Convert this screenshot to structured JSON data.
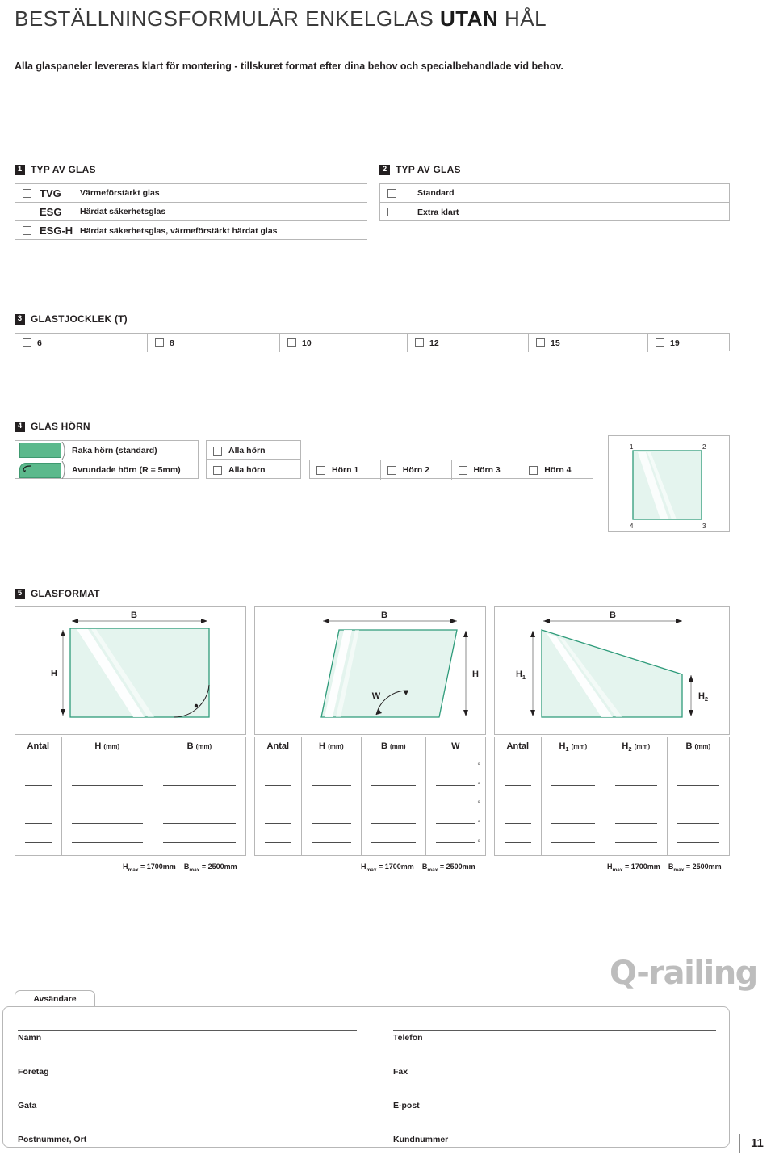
{
  "header": {
    "title_normal_1": "BESTÄLLNINGSFORMULÄR ENKELGLAS ",
    "title_bold": "UTAN",
    "title_normal_2": " HÅL",
    "subtitle": "Alla glaspaneler levereras klart för montering - tillskuret format efter dina behov och specialbehandlade vid behov."
  },
  "colors": {
    "glass_fill": "#e4f4ee",
    "glass_stroke": "#2e9b7a",
    "swatch_green": "#5cb98c",
    "rule": "#b7b7b7",
    "logo_gray": "#bdbdbd"
  },
  "section1": {
    "number": "1",
    "title": "TYP AV GLAS",
    "options": [
      {
        "code": "TVG",
        "desc": "Värmeförstärkt glas"
      },
      {
        "code": "ESG",
        "desc": "Härdat säkerhetsglas"
      },
      {
        "code": "ESG-H",
        "desc": "Härdat säkerhetsglas, värmeförstärkt härdat glas"
      }
    ]
  },
  "section2": {
    "number": "2",
    "title": "TYP AV GLAS",
    "options": [
      {
        "label": "Standard"
      },
      {
        "label": "Extra klart"
      }
    ]
  },
  "section3": {
    "number": "3",
    "title": "GLASTJOCKLEK (T)",
    "thicknesses": [
      "6",
      "8",
      "10",
      "12",
      "15",
      "19"
    ]
  },
  "section4": {
    "number": "4",
    "title": "GLAS HÖRN",
    "types": [
      {
        "label": "Raka hörn (standard)",
        "swatch": "square-corner-swatch"
      },
      {
        "label": "Avrundade hörn (R = 5mm)",
        "swatch": "rounded-corner-swatch"
      }
    ],
    "all_corners_1": "Alla hörn",
    "all_corners_2": "Alla hörn",
    "corners": [
      "Hörn 1",
      "Hörn 2",
      "Hörn 3",
      "Hörn 4"
    ],
    "diagram_corner_labels": [
      "1",
      "2",
      "3",
      "4"
    ]
  },
  "section5": {
    "number": "5",
    "title": "GLASFORMAT",
    "figures": [
      {
        "name": "rectangle-glass",
        "labels": {
          "b": "B",
          "h": "H"
        }
      },
      {
        "name": "parallelogram-glass",
        "labels": {
          "b": "B",
          "h": "H",
          "w": "W"
        }
      },
      {
        "name": "trapezoid-glass",
        "labels": {
          "b": "B",
          "h1": "H",
          "h1sub": "1",
          "h2": "H",
          "h2sub": "2"
        }
      }
    ],
    "tables": [
      {
        "name": "rectangle-table",
        "headers": [
          {
            "main": "Antal",
            "unit": ""
          },
          {
            "main": "H",
            "unit": "(mm)"
          },
          {
            "main": "B",
            "unit": "(mm)"
          }
        ],
        "rows": 5,
        "max_note": {
          "h": "H",
          "hsub": "max",
          "heq": "= 1700mm",
          "dash": "–",
          "b": "B",
          "bsub": "max",
          "beq": "= 2500mm"
        }
      },
      {
        "name": "parallelogram-table",
        "headers": [
          {
            "main": "Antal",
            "unit": ""
          },
          {
            "main": "H",
            "unit": "(mm)"
          },
          {
            "main": "B",
            "unit": "(mm)"
          },
          {
            "main": "W",
            "unit": ""
          }
        ],
        "rows": 5,
        "degree_symbol": "°",
        "max_note": {
          "h": "H",
          "hsub": "max",
          "heq": "= 1700mm",
          "dash": "–",
          "b": "B",
          "bsub": "max",
          "beq": "= 2500mm"
        }
      },
      {
        "name": "trapezoid-table",
        "headers": [
          {
            "main": "Antal",
            "unit": ""
          },
          {
            "main": "H",
            "sub": "1",
            "unit": "(mm)"
          },
          {
            "main": "H",
            "sub": "2",
            "unit": "(mm)"
          },
          {
            "main": "B",
            "unit": "(mm)"
          }
        ],
        "rows": 5,
        "max_note": {
          "h": "H",
          "hsub": "max",
          "heq": "= 1700mm",
          "dash": "–",
          "b": "B",
          "bsub": "max",
          "beq": "= 2500mm"
        }
      }
    ]
  },
  "brand": {
    "logo_text": "Q-railing"
  },
  "sender": {
    "tab_label": "Avsändare",
    "left_fields": [
      "Namn",
      "Företag",
      "Gata",
      "Postnummer, Ort"
    ],
    "right_fields": [
      "Telefon",
      "Fax",
      "E-post",
      "Kundnummer"
    ]
  },
  "footer": {
    "page_number": "11"
  }
}
